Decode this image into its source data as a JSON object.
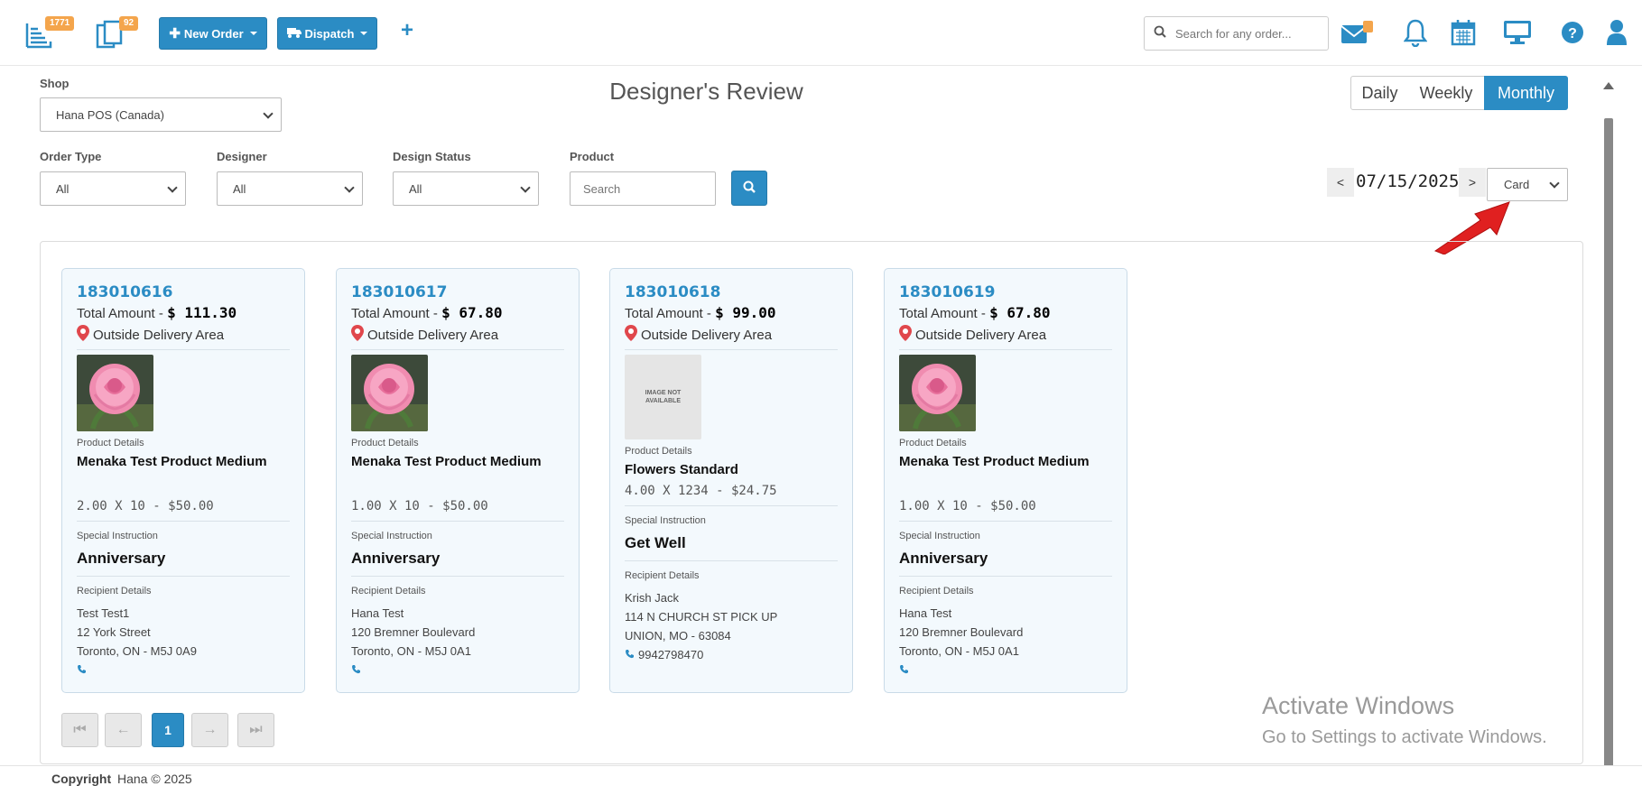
{
  "topbar": {
    "orders_badge": "1771",
    "copies_badge": "92",
    "new_order_label": "New Order",
    "dispatch_label": "Dispatch",
    "add_label": "+",
    "search_placeholder": "Search for any order..."
  },
  "filters": {
    "shop_label": "Shop",
    "shop_value": "Hana POS (Canada)",
    "order_type_label": "Order Type",
    "order_type_value": "All",
    "designer_label": "Designer",
    "designer_value": "All",
    "design_status_label": "Design Status",
    "design_status_value": "All",
    "product_label": "Product",
    "product_placeholder": "Search"
  },
  "page_title": "Designer's Review",
  "range_tabs": [
    {
      "label": "Daily",
      "active": false
    },
    {
      "label": "Weekly",
      "active": false
    },
    {
      "label": "Monthly",
      "active": true
    }
  ],
  "date_nav": {
    "prev": "<",
    "date": "07/15/2025",
    "next": ">"
  },
  "view_select": "Card",
  "card_labels": {
    "total_amount": "Total Amount - ",
    "product_details": "Product Details",
    "special_instruction": "Special Instruction",
    "recipient_details": "Recipient Details"
  },
  "cards": [
    {
      "order_id": "183010616",
      "total": "$ 111.30",
      "location": "Outside Delivery Area",
      "image": "rose",
      "product_name": "Menaka Test Product Medium",
      "product_price": "2.00 X 10 - $50.00",
      "instruction": "Anniversary",
      "recipient_name": "Test Test1",
      "recipient_street": "12 York Street",
      "recipient_city": "Toronto, ON - M5J 0A9",
      "phone": ""
    },
    {
      "order_id": "183010617",
      "total": "$ 67.80",
      "location": "Outside Delivery Area",
      "image": "rose",
      "product_name": "Menaka Test Product Medium",
      "product_price": "1.00 X 10 - $50.00",
      "instruction": "Anniversary",
      "recipient_name": "Hana Test",
      "recipient_street": "120 Bremner Boulevard",
      "recipient_city": "Toronto, ON - M5J 0A1",
      "phone": ""
    },
    {
      "order_id": "183010618",
      "total": "$ 99.00",
      "location": "Outside Delivery Area",
      "image": "not-available",
      "image_text": "IMAGE NOT AVAILABLE",
      "product_name": "Flowers Standard",
      "product_price": "4.00 X 1234 - $24.75",
      "instruction": "Get Well",
      "recipient_name": "Krish Jack",
      "recipient_street": "114 N CHURCH ST PICK UP",
      "recipient_city": "UNION, MO - 63084",
      "phone": "9942798470"
    },
    {
      "order_id": "183010619",
      "total": "$ 67.80",
      "location": "Outside Delivery Area",
      "image": "rose",
      "product_name": "Menaka Test Product Medium",
      "product_price": "1.00 X 10 - $50.00",
      "instruction": "Anniversary",
      "recipient_name": "Hana Test",
      "recipient_street": "120 Bremner Boulevard",
      "recipient_city": "Toronto, ON - M5J 0A1",
      "phone": ""
    }
  ],
  "pagination": {
    "first": "⏮",
    "prev": "←",
    "current": "1",
    "next": "→",
    "last": "⏭"
  },
  "watermark": {
    "line1": "Activate Windows",
    "line2": "Go to Settings to activate Windows."
  },
  "footer": {
    "copyright": "Copyright",
    "text": "Hana © 2025"
  },
  "colors": {
    "accent": "#2b8cc4",
    "badge": "#f4a54c",
    "pin": "#e0474c",
    "arrow": "#e02020"
  }
}
